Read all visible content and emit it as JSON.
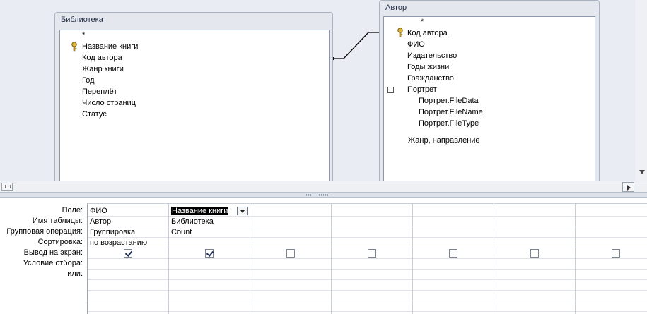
{
  "tables": {
    "library": {
      "title": "Библиотека",
      "fields": [
        "*",
        "Название книги",
        "Код автора",
        "Жанр книги",
        "Год",
        "Переплёт",
        "Число страниц",
        "Статус"
      ]
    },
    "author": {
      "title": "Автор",
      "fields": [
        "*",
        "Код автора",
        "ФИО",
        "Издательство",
        "Годы жизни",
        "Гражданство",
        "Портрет",
        "Портрет.FileData",
        "Портрет.FileName",
        "Портрет.FileType",
        "Жанр, направление"
      ]
    }
  },
  "grid": {
    "row_labels": [
      "Поле:",
      "Имя таблицы:",
      "Групповая операция:",
      "Сортировка:",
      "Вывод на экран:",
      "Условие отбора:",
      "или:"
    ],
    "columns": [
      {
        "field": "ФИО",
        "table": "Автор",
        "total": "Группировка",
        "sort": "по возрастанию",
        "show": true
      },
      {
        "field": "Название книги",
        "table": "Библиотека",
        "total": "Count",
        "sort": "",
        "show": true
      },
      {
        "field": "",
        "table": "",
        "total": "",
        "sort": "",
        "show": false
      },
      {
        "field": "",
        "table": "",
        "total": "",
        "sort": "",
        "show": false
      },
      {
        "field": "",
        "table": "",
        "total": "",
        "sort": "",
        "show": false
      },
      {
        "field": "",
        "table": "",
        "total": "",
        "sort": "",
        "show": false
      },
      {
        "field": "",
        "table": "",
        "total": "",
        "sort": "",
        "show": false
      }
    ]
  },
  "colors": {
    "diagram_bg": "#e9edf3",
    "selection": "#000000",
    "key_icon": "#c8a326",
    "relation_line": "#000000"
  },
  "icons": {
    "primary_key": "key-icon",
    "collapse": "minus-box-icon",
    "dropdown": "chevron-down-icon"
  }
}
